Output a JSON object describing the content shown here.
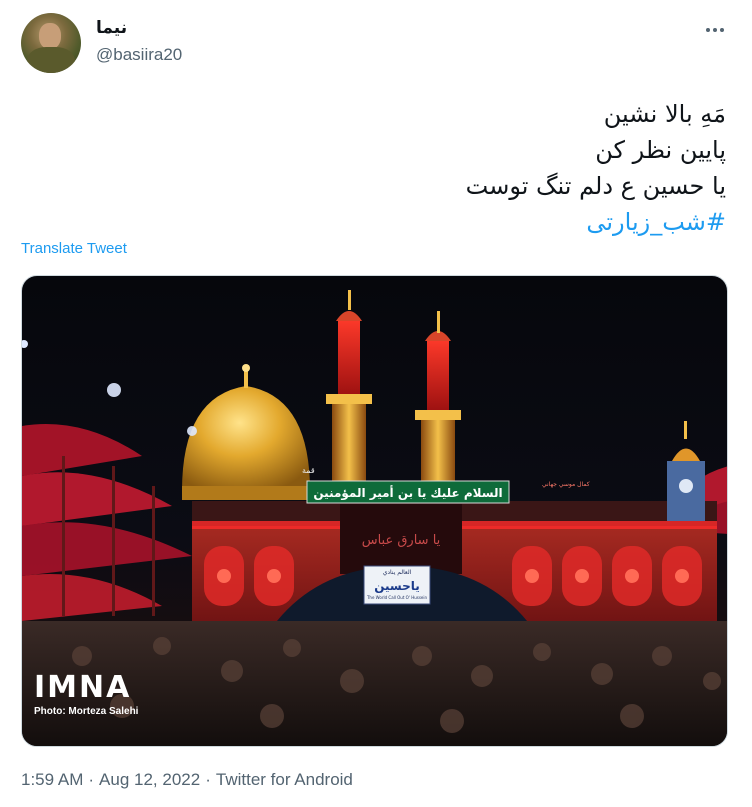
{
  "author": {
    "display_name": "نیما",
    "handle": "@basiira20"
  },
  "tweet": {
    "lines": [
      "مَهِ بالا نشین",
      "پایین نظر کن",
      "یا حسین ع دلم تنگ توست"
    ],
    "hashtag": "#شب_زیارتی",
    "translate_label": "Translate Tweet"
  },
  "media": {
    "signs": {
      "main_banner": "السلام عليك يا بن أمير المؤمنين",
      "bottom_sign": "ياحسين",
      "bottom_sign_top": "العالم ينادي",
      "bottom_sign_sub": "The World Call Out O' Hussein",
      "door_text": "يا سارق عباس",
      "left_corner": "قمة",
      "right_sign": "كمال موسي جهاني"
    },
    "watermark": "IMNA",
    "credit": "Photo: Morteza Salehi"
  },
  "meta": {
    "time": "1:59 AM",
    "date": "Aug 12, 2022",
    "separator": "·",
    "source": "Twitter for Android"
  },
  "colors": {
    "link": "#1d9bf0",
    "secondary_text": "#536471",
    "primary_text": "#0f1419"
  },
  "icons": {
    "more": "more-horizontal-icon"
  }
}
